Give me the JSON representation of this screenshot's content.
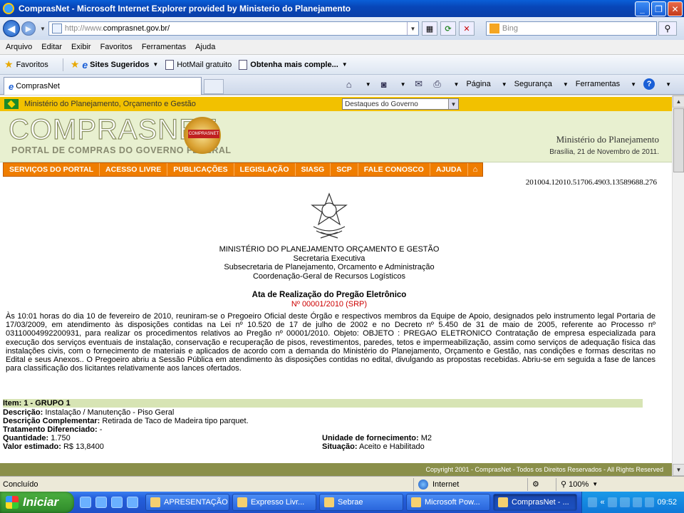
{
  "window": {
    "title": "ComprasNet - Microsoft Internet Explorer provided by Ministerio do Planejamento",
    "min": "_",
    "max": "❐",
    "close": "✕"
  },
  "address": {
    "url_prefix": "http://www.",
    "url_host": "comprasnet.gov.br/",
    "search_placeholder": "Bing"
  },
  "menu": [
    "Arquivo",
    "Editar",
    "Exibir",
    "Favoritos",
    "Ferramentas",
    "Ajuda"
  ],
  "favorites": {
    "label": "Favoritos",
    "items": [
      "Sites Sugeridos",
      "HotMail gratuito",
      "Obtenha mais comple..."
    ]
  },
  "tab": {
    "label": "ComprasNet"
  },
  "commandbar": {
    "page": "Página",
    "security": "Segurança",
    "tools": "Ferramentas"
  },
  "site": {
    "gov_label": "Ministério do Planejamento, Orçamento e Gestão",
    "gov_select": "Destaques do Governo",
    "logo": "COMPRASNET",
    "logo_sub": "PORTAL DE COMPRAS DO GOVERNO FEDERAL",
    "seal": "COMPRASNET",
    "ministry": "Ministério do Planejamento",
    "date": "Brasília, 21 de Novembro de 2011.",
    "nav": [
      "SERVIÇOS DO PORTAL",
      "ACESSO LIVRE",
      "PUBLICAÇÕES",
      "LEGISLAÇÃO",
      "SIASG",
      "SCP",
      "FALE CONOSCO",
      "AJUDA"
    ],
    "copyright": "Copyright 2001 - ComprasNet - Todos os Direitos Reservados - All Rights Reserved"
  },
  "document": {
    "code": "201004.12010.51706.4903.13589688.276",
    "header": [
      "MINISTÉRIO DO PLANEJAMENTO ORÇAMENTO E GESTÃO",
      "Secretaria Executiva",
      "Subsecretaria de Planejamento, Orcamento e Administração",
      "Coordenação-Geral de Recursos Logísticos"
    ],
    "title": "Ata de Realização do Pregão Eletrônico",
    "number": "Nº 00001/2010 (SRP)",
    "paragraph": "Às 10:01 horas do dia 10 de fevereiro de 2010, reuniram-se o Pregoeiro Oficial deste Órgão e respectivos membros da Equipe de Apoio, designados pelo instrumento legal Portaria de 17/03/2009, em atendimento às disposições contidas na Lei nº 10.520 de 17 de julho de 2002 e no Decreto nº 5.450 de 31 de maio de 2005, referente ao Processo nº 03110004992200931, para realizar os procedimentos relativos ao Pregão nº 00001/2010. Objeto: OBJETO : PREGAO ELETRONICO Contratação de empresa especializada para execução dos serviços eventuais de instalação, conservação e recuperação de pisos, revestimentos, paredes, tetos e impermeabilização, assim como serviços de adequação física das instalações civis, com o fornecimento de materiais e aplicados de acordo com a demanda do Ministério do Planejamento, Orçamento e Gestão, nas condições e formas descritas no Edital e seus Anexos.. O Pregoeiro abriu a Sessão Pública em atendimento às disposições contidas no edital, divulgando as propostas recebidas. Abriu-se em seguida a fase de lances para classificação dos licitantes relativamente aos lances ofertados.",
    "item": {
      "heading": "Item: 1 - GRUPO 1",
      "desc_label": "Descrição:",
      "desc": "Instalação / Manutenção - Piso Geral",
      "comp_label": "Descrição Complementar:",
      "comp": "Retirada de Taco de Madeira tipo parquet.",
      "trat_label": "Tratamento Diferenciado:",
      "trat": "-",
      "qty_label": "Quantidade:",
      "qty": "1.750",
      "val_label": "Valor estimado:",
      "val": "R$ 13,8400",
      "unit_label": "Unidade de fornecimento:",
      "unit": "M2",
      "sit_label": "Situação:",
      "sit": "Aceito e Habilitado"
    }
  },
  "status": {
    "text": "Concluído",
    "zone": "Internet",
    "zoom": "100%"
  },
  "taskbar": {
    "start": "Iniciar",
    "tasks": [
      "APRESENTAÇÃO",
      "Expresso Livr...",
      "Sebrae",
      "Microsoft Pow...",
      "ComprasNet - ..."
    ],
    "clock": "09:52"
  }
}
